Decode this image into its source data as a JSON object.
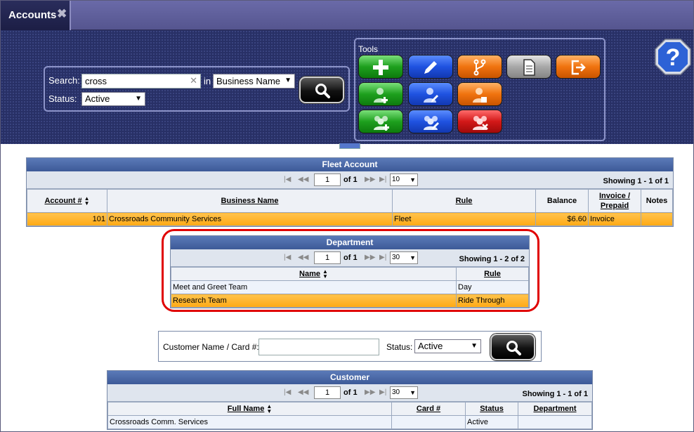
{
  "tab": {
    "label": "Accounts",
    "close_glyph": "✖"
  },
  "search": {
    "label": "Search:",
    "value": "cross",
    "clear_glyph": "✕",
    "in_label": "in",
    "field_select": "Business Name",
    "status_label": "Status:",
    "status_select": "Active"
  },
  "tools": {
    "title": "Tools",
    "buttons": [
      {
        "icon": "add-icon",
        "color": "green"
      },
      {
        "icon": "edit-icon",
        "color": "blue"
      },
      {
        "icon": "branch-icon",
        "color": "orange"
      },
      {
        "icon": "document-icon",
        "color": "silver"
      },
      {
        "icon": "exit-icon",
        "color": "orange"
      },
      {
        "icon": "add-user-icon",
        "color": "green"
      },
      {
        "icon": "edit-user-icon",
        "color": "blue"
      },
      {
        "icon": "lock-user-icon",
        "color": "orange"
      },
      {
        "icon": "add-group-icon",
        "color": "green"
      },
      {
        "icon": "edit-group-icon",
        "color": "blue"
      },
      {
        "icon": "delete-group-icon",
        "color": "red"
      }
    ]
  },
  "help": {
    "glyph": "?"
  },
  "fleet": {
    "title": "Fleet Account",
    "page": "1",
    "of": "of 1",
    "page_size": "10",
    "showing": "Showing 1 - 1 of 1",
    "columns": [
      "Account #",
      "Business Name",
      "Rule",
      "Balance",
      "Invoice /",
      "Prepaid",
      "Notes"
    ],
    "rows": [
      {
        "account": "101",
        "name": "Crossroads Community Services",
        "rule": "Fleet",
        "balance": "$6.60",
        "invoice": "Invoice",
        "notes": ""
      }
    ]
  },
  "department": {
    "title": "Department",
    "page": "1",
    "of": "of 1",
    "page_size": "30",
    "showing": "Showing 1 - 2 of 2",
    "columns": [
      "Name",
      "Rule"
    ],
    "rows": [
      {
        "name": "Meet and Greet Team",
        "rule": "Day"
      },
      {
        "name": "Research Team",
        "rule": "Ride Through"
      }
    ]
  },
  "customer_search": {
    "label": "Customer Name / Card #:",
    "value": "",
    "status_label": "Status:",
    "status_select": "Active"
  },
  "customer": {
    "title": "Customer",
    "page": "1",
    "of": "of 1",
    "page_size": "30",
    "showing": "Showing 1 - 1 of 1",
    "columns": [
      "Full Name",
      "Card #",
      "Status",
      "Department"
    ],
    "rows": [
      {
        "name": "Crossroads Comm. Services",
        "card": "",
        "status": "Active",
        "department": ""
      }
    ]
  },
  "pager_glyphs": {
    "first": "|◀",
    "prev": "◀◀",
    "next": "▶▶",
    "last": "▶|",
    "caret": "▼",
    "sort": "▲▼"
  }
}
